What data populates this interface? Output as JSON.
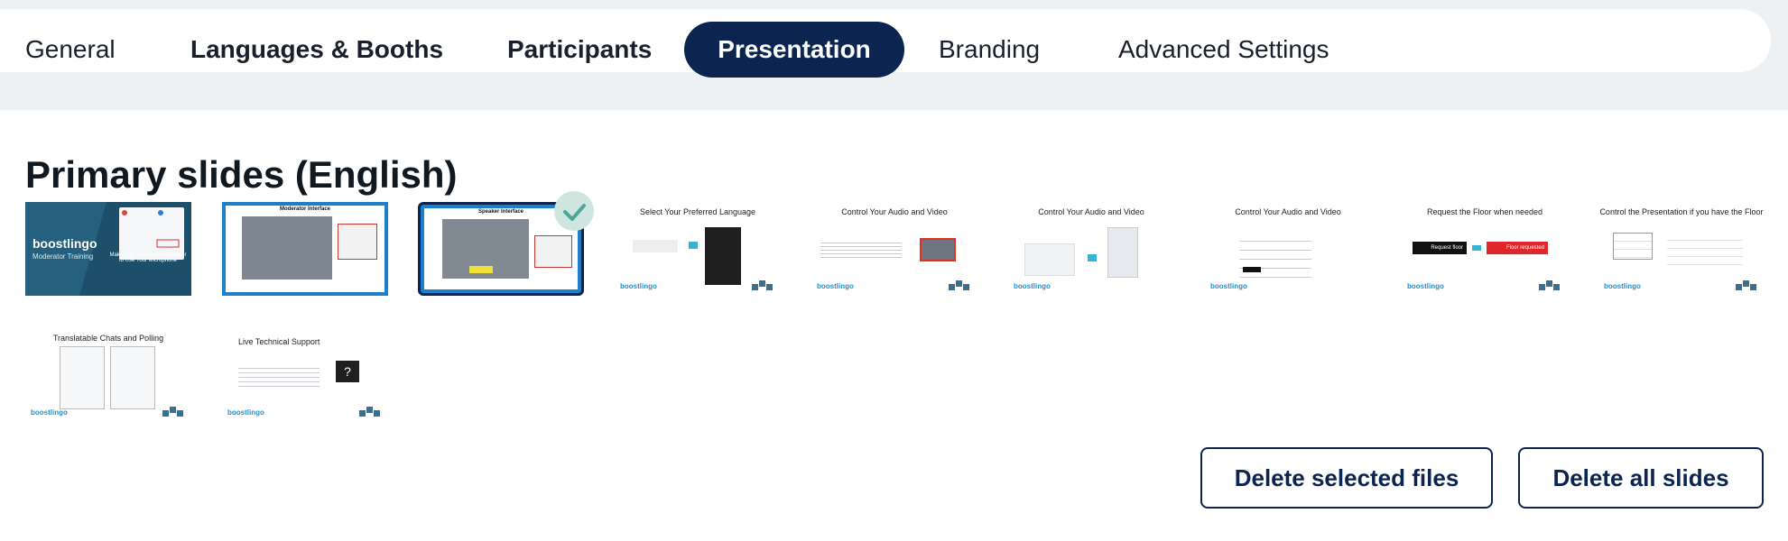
{
  "tabs": [
    {
      "label": "General"
    },
    {
      "label": "Languages & Booths"
    },
    {
      "label": "Participants"
    },
    {
      "label": "Presentation"
    },
    {
      "label": "Branding"
    },
    {
      "label": "Advanced Settings"
    }
  ],
  "section_title": "Primary slides (English)",
  "slides": [
    {
      "title": "",
      "caption_a": "boostlingo",
      "caption_b": "Moderator Training",
      "caption_c": "Make Sure to Allow the Browser to Use Your Microphone"
    },
    {
      "title": "Moderator Interface"
    },
    {
      "title": "Speaker Interface",
      "selected": true
    },
    {
      "title": "Select Your Preferred Language"
    },
    {
      "title": "Control Your Audio and Video"
    },
    {
      "title": "Control Your Audio and Video"
    },
    {
      "title": "Control Your Audio and Video"
    },
    {
      "title": "Request the Floor when needed"
    },
    {
      "title": "Control the Presentation if you have the Floor"
    },
    {
      "title": "Translatable Chats and Polling"
    },
    {
      "title": "Live Technical Support"
    }
  ],
  "slide_text": {
    "request_floor": "Request floor",
    "floor_requested": "Floor requested",
    "brand": "boostlingo"
  },
  "buttons": {
    "delete_selected": "Delete selected files",
    "delete_all": "Delete all slides"
  },
  "colors": {
    "accent": "#0c2450",
    "brand_blue": "#2a8fc7",
    "check_bg": "#cfe5e0",
    "check_mark": "#4aa79a"
  },
  "icons": {
    "selected_check": "check-icon"
  }
}
